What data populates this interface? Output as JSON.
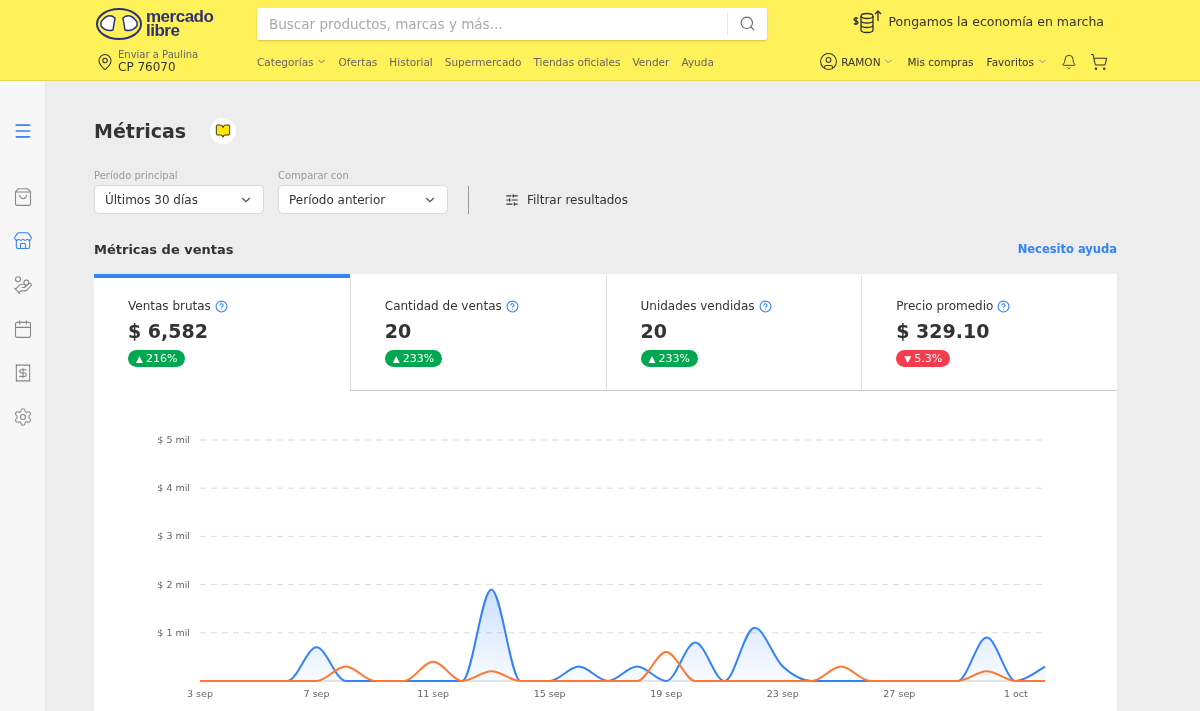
{
  "header": {
    "logo": {
      "line1": "mercado",
      "line2": "libre"
    },
    "search": {
      "placeholder": "Buscar productos, marcas y más…"
    },
    "promo": "Pongamos la economía en marcha",
    "shipping": {
      "label": "Enviar a Paulina",
      "code": "CP 76070"
    },
    "nav": [
      {
        "label": "Categorías",
        "dropdown": true
      },
      {
        "label": "Ofertas",
        "dropdown": false
      },
      {
        "label": "Historial",
        "dropdown": false
      },
      {
        "label": "Supermercado",
        "dropdown": false
      },
      {
        "label": "Tiendas oficiales",
        "dropdown": false
      },
      {
        "label": "Vender",
        "dropdown": false
      },
      {
        "label": "Ayuda",
        "dropdown": false
      }
    ],
    "user": {
      "name": "RAMON"
    },
    "user_links": [
      {
        "label": "Mis compras",
        "dropdown": false
      },
      {
        "label": "Favoritos",
        "dropdown": true
      }
    ]
  },
  "sidebar": {
    "items": [
      {
        "kind": "bag",
        "selected": false
      },
      {
        "kind": "store",
        "selected": true
      },
      {
        "kind": "money",
        "selected": false
      },
      {
        "kind": "calendar",
        "selected": false
      },
      {
        "kind": "receipt",
        "selected": false
      },
      {
        "kind": "settings",
        "selected": false
      }
    ]
  },
  "page": {
    "title": "Métricas",
    "filters": [
      {
        "label": "Período principal",
        "value": "Últimos 30 días"
      },
      {
        "label": "Comparar con",
        "value": "Período anterior"
      }
    ],
    "filter_button": "Filtrar resultados",
    "section": {
      "title": "Métricas de ventas",
      "help_link": "Necesito ayuda"
    },
    "metrics": [
      {
        "label": "Ventas brutas",
        "value": "$ 6,582",
        "arrow": "▲",
        "change": "216%",
        "color": "#00a650",
        "selected": true
      },
      {
        "label": "Cantidad de ventas",
        "value": "20",
        "arrow": "▲",
        "change": "233%",
        "color": "#00a650",
        "selected": false
      },
      {
        "label": "Unidades vendidas",
        "value": "20",
        "arrow": "▲",
        "change": "233%",
        "color": "#00a650",
        "selected": false
      },
      {
        "label": "Precio promedio",
        "value": "$ 329.10",
        "arrow": "▼",
        "change": "5.3%",
        "color": "#f23d4f",
        "selected": false
      }
    ],
    "chart_data": {
      "type": "area",
      "grid": true,
      "categories": [
        "3 sep",
        null,
        null,
        null,
        "7 sep",
        null,
        null,
        null,
        "11 sep",
        null,
        null,
        null,
        "15 sep",
        null,
        null,
        null,
        "19 sep",
        null,
        null,
        null,
        "23 sep",
        null,
        null,
        null,
        "27 sep",
        null,
        null,
        null,
        "1 oct",
        null
      ],
      "yticks": [
        {
          "value": 1,
          "label": "$ 1 mil"
        },
        {
          "value": 2,
          "label": "$ 2 mil"
        },
        {
          "value": 3,
          "label": "$ 3 mil"
        },
        {
          "value": 4,
          "label": "$ 4 mil"
        },
        {
          "value": 5,
          "label": "$ 5 mil"
        }
      ],
      "ylim": [
        0,
        5
      ],
      "series": [
        {
          "type": "area",
          "color": "#3483fa",
          "values": [
            0,
            0,
            0,
            0,
            0.7,
            0,
            0,
            0,
            0,
            0,
            1.9,
            0,
            0,
            0.3,
            0,
            0.3,
            0,
            0.8,
            0,
            1.1,
            0.3,
            0,
            0,
            0,
            0,
            0,
            0,
            0.9,
            0,
            0.3
          ]
        },
        {
          "type": "line",
          "color": "#ff7733",
          "values": [
            0,
            0,
            0,
            0,
            0,
            0.3,
            0,
            0,
            0.4,
            0,
            0.2,
            0,
            0,
            0,
            0,
            0,
            0.6,
            0,
            0,
            0,
            0,
            0,
            0.3,
            0,
            0,
            0,
            0,
            0.2,
            0,
            0
          ]
        }
      ]
    }
  }
}
